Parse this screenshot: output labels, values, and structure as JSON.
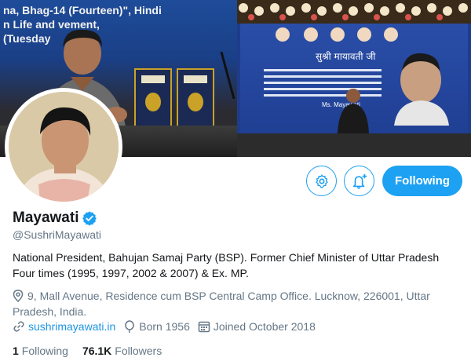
{
  "header": {
    "banner_text_line1": "na, Bhag-14 (Fourteen)\", Hindi",
    "banner_text_line2": "n Life and    vement,",
    "banner_text_line3": "(Tuesday",
    "stage_sign": "सुश्री मायावती जी",
    "stage_sign_name": "Ms. Mayawati"
  },
  "actions": {
    "settings_icon": "gear-icon",
    "notify_icon": "bell-plus-icon",
    "follow_label": "Following"
  },
  "profile": {
    "name": "Mayawati",
    "verified_icon": "verified-badge-icon",
    "handle": "@SushriMayawati",
    "bio_line1": "National President, Bahujan Samaj Party (BSP). Former Chief Minister of Uttar Pradesh",
    "bio_line2": "Four times (1995, 1997, 2002 & 2007)  & Ex. MP.",
    "location": "9, Mall Avenue, Residence cum BSP Central Camp Office. Lucknow, 226001, Uttar Pradesh, India.",
    "website": "sushrimayawati.in",
    "born": "Born 1956",
    "joined": "Joined October 2018"
  },
  "stats": {
    "following_count": "1",
    "following_label": "Following",
    "followers_count": "76.1K",
    "followers_label": "Followers"
  },
  "colors": {
    "accent": "#1da1f2",
    "link": "#1b95e0",
    "secondary_text": "#657786",
    "primary_text": "#14171a"
  }
}
